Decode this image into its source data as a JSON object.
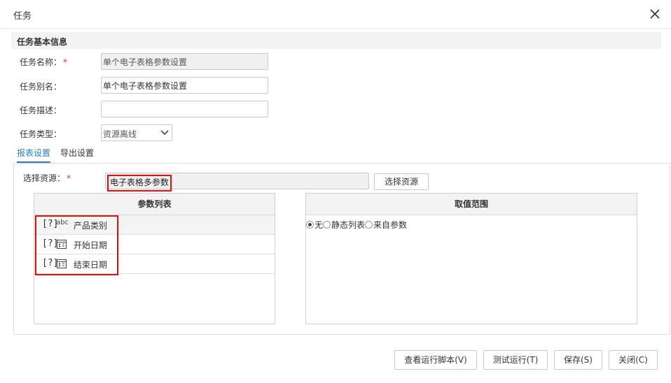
{
  "dialog": {
    "title": "任务"
  },
  "basic_info": {
    "heading": "任务基本信息",
    "name_label": "任务名称：",
    "name_value": "单个电子表格参数设置",
    "alias_label": "任务别名：",
    "alias_value": "单个电子表格参数设置",
    "desc_label": "任务描述：",
    "desc_value": "",
    "type_label": "任务类型：",
    "type_value": "资源离线",
    "required_mark": "*"
  },
  "tabs": [
    {
      "label": "报表设置",
      "active": true
    },
    {
      "label": "导出设置",
      "active": false
    }
  ],
  "report_settings": {
    "resource_label": "选择资源：",
    "resource_value": "电子表格多参数",
    "select_resource_button": "选择资源",
    "param_list": {
      "header": "参数列表",
      "items": [
        {
          "prefix": "[?]",
          "icon": "abc-text-icon",
          "icon_text": "abc",
          "name": "产品类别"
        },
        {
          "prefix": "[?]",
          "icon": "date-icon",
          "name": "开始日期"
        },
        {
          "prefix": "[?]",
          "icon": "date-icon",
          "name": "结束日期"
        }
      ]
    },
    "value_range": {
      "header": "取值范围",
      "options": [
        {
          "label": "无",
          "checked": true
        },
        {
          "label": "静态列表",
          "checked": false
        },
        {
          "label": "来自参数",
          "checked": false
        }
      ]
    }
  },
  "footer": {
    "view_script_button": "查看运行脚本(V)",
    "test_run_button": "测试运行(T)",
    "save_button": "保存(S)",
    "close_button": "关闭(C)"
  },
  "colors": {
    "accent": "#2a7ac7",
    "highlight": "#e01010",
    "required": "#ee2233"
  }
}
